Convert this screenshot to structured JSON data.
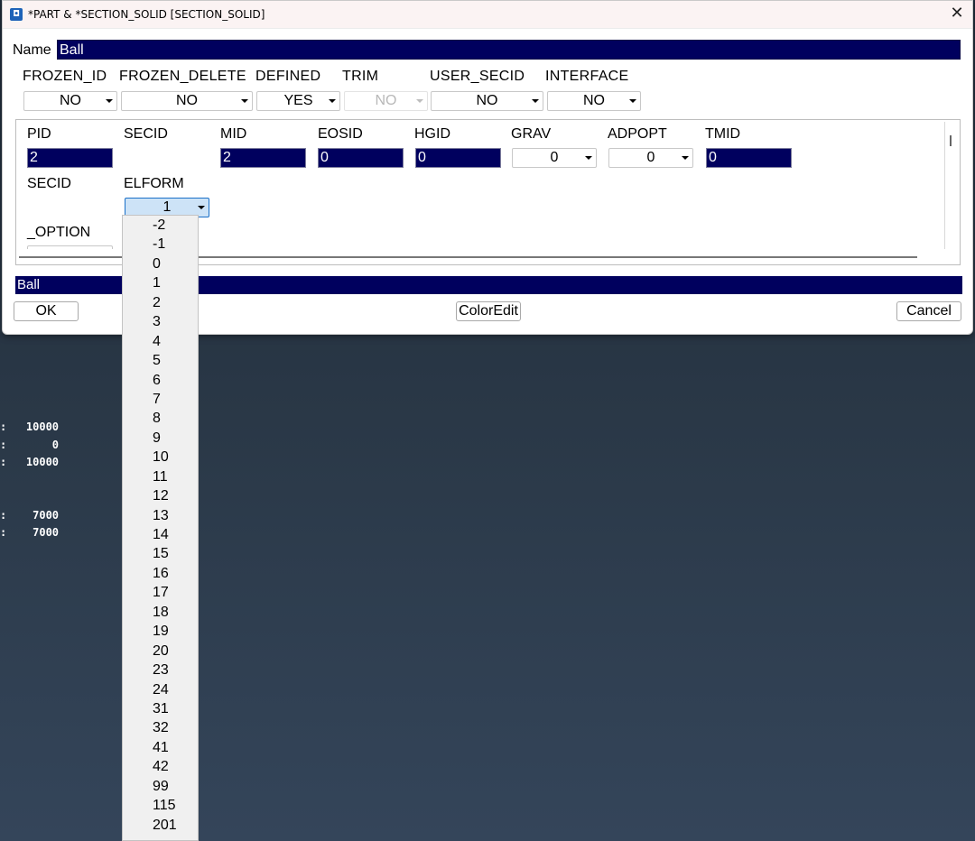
{
  "window": {
    "title": "*PART & *SECTION_SOLID [SECTION_SOLID]",
    "close_glyph": "✕",
    "icon": "app-logo-icon"
  },
  "name_field": {
    "label": "Name",
    "value": "Ball"
  },
  "flags": [
    {
      "label": "FROZEN_ID",
      "value": "NO",
      "enabled": true
    },
    {
      "label": "FROZEN_DELETE",
      "value": "NO",
      "enabled": true
    },
    {
      "label": "DEFINED",
      "value": "YES",
      "enabled": true
    },
    {
      "label": "TRIM",
      "value": "NO",
      "enabled": false
    },
    {
      "label": "USER_SECID",
      "value": "NO",
      "enabled": true
    },
    {
      "label": "INTERFACE",
      "value": "NO",
      "enabled": true
    }
  ],
  "part": {
    "labels": {
      "pid": "PID",
      "secid": "SECID",
      "mid": "MID",
      "eosid": "EOSID",
      "hgid": "HGID",
      "grav": "GRAV",
      "adpopt": "ADPOPT",
      "tmid": "TMID"
    },
    "values": {
      "pid": "2",
      "mid": "2",
      "eosid": "0",
      "hgid": "0",
      "grav": "0",
      "adpopt": "0",
      "tmid": "0"
    }
  },
  "section": {
    "secid_label": "SECID",
    "elform_label": "ELFORM",
    "elform_value": "1",
    "option_label": "_OPTION"
  },
  "bottom_name": "Ball",
  "buttons": {
    "ok": "OK",
    "coloredit": "ColorEdit",
    "cancel": "Cancel"
  },
  "elform_options": [
    "-2",
    "-1",
    "0",
    "1",
    "2",
    "3",
    "4",
    "5",
    "6",
    "7",
    "8",
    "9",
    "10",
    "11",
    "12",
    "13",
    "14",
    "15",
    "16",
    "17",
    "18",
    "19",
    "20",
    "23",
    "24",
    "31",
    "32",
    "41",
    "42",
    "99",
    "115",
    "201"
  ],
  "console": {
    "lines_a": [
      ":   10000",
      ":       0",
      ":   10000"
    ],
    "lines_b": [
      ":    7000",
      ":    7000"
    ]
  },
  "colors": {
    "field_bg": "#00005e",
    "active_dropdown": "#cde3f7"
  }
}
